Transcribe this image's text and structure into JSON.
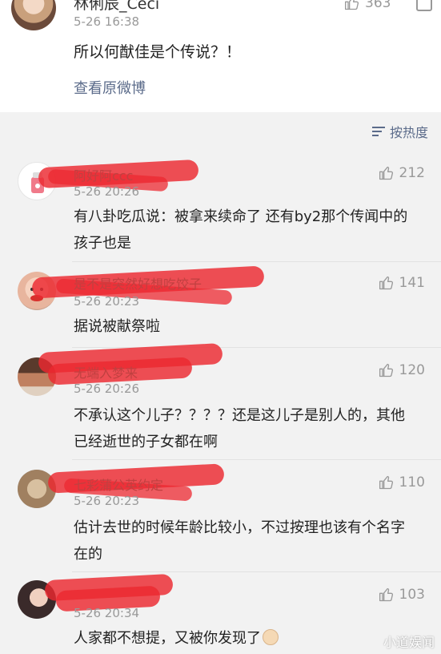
{
  "top": {
    "username": "林俐辰_Ceci",
    "time": "5-26 16:38",
    "likes": "363",
    "text": "所以何猷佳是个传说？！",
    "view_original": "查看原微博"
  },
  "sort": {
    "label": "按热度",
    "icon": "sort-lines-icon"
  },
  "comments": [
    {
      "username": "阿好阿ccc",
      "time": "5-26 20:26",
      "likes": "212",
      "text": "有八卦吃瓜说：被拿来续命了 还有by2那个传闻中的孩子也是"
    },
    {
      "username": "是不是突然好想吃饺子",
      "time": "5-26 20:23",
      "likes": "141",
      "text": "据说被献祭啦"
    },
    {
      "username": "无端入梦来",
      "time": "5-26 20:26",
      "likes": "120",
      "text": "不承认这个儿子？？？？还是这儿子是别人的，其他已经逝世的子女都在啊"
    },
    {
      "username": "七彩蒲公英约定",
      "time": "5-26 20:23",
      "likes": "110",
      "text": "估计去世的时候年龄比较小，不过按理也该有个名字在的"
    },
    {
      "username": "",
      "time": "5-26 20:34",
      "likes": "103",
      "text": "人家都不想提，又被你发现了"
    }
  ],
  "watermark": "小道娱闻",
  "colors": {
    "link": "#5b6b8a",
    "redact": "#ec2830",
    "meta": "#999999"
  }
}
